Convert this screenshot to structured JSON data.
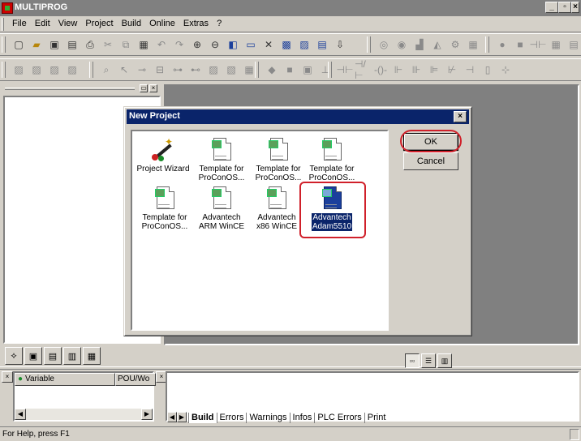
{
  "window": {
    "title": "MULTIPROG"
  },
  "menu": [
    "File",
    "Edit",
    "View",
    "Project",
    "Build",
    "Online",
    "Extras",
    "?"
  ],
  "dialog": {
    "title": "New Project",
    "templates": [
      {
        "line1": "Project Wizard",
        "line2": "",
        "icon": "wizard-icon",
        "selected": false
      },
      {
        "line1": "Template for",
        "line2": "ProConOS...",
        "icon": "template-icon",
        "selected": false
      },
      {
        "line1": "Template for",
        "line2": "ProConOS...",
        "icon": "template-icon",
        "selected": false
      },
      {
        "line1": "Template for",
        "line2": "ProConOS...",
        "icon": "template-icon",
        "selected": false
      },
      {
        "line1": "Template for",
        "line2": "ProConOS...",
        "icon": "template-icon",
        "selected": false
      },
      {
        "line1": "Advantech",
        "line2": "ARM WinCE",
        "icon": "template-icon",
        "selected": false
      },
      {
        "line1": "Advantech",
        "line2": "x86 WinCE",
        "icon": "template-icon",
        "selected": false
      },
      {
        "line1": "Advantech",
        "line2": "Adam5510",
        "icon": "template-icon",
        "selected": true
      }
    ],
    "ok_label": "OK",
    "cancel_label": "Cancel"
  },
  "watch": {
    "col_variable": "Variable",
    "col_pou": "POU/Wo"
  },
  "output_tabs": [
    "Build",
    "Errors",
    "Warnings",
    "Infos",
    "PLC Errors",
    "Print"
  ],
  "status": {
    "text": "For Help, press F1"
  },
  "colors": {
    "titlebar_inactive": "#808080",
    "dialog_title": "#0a246a",
    "highlight_ring": "#d0202a"
  }
}
